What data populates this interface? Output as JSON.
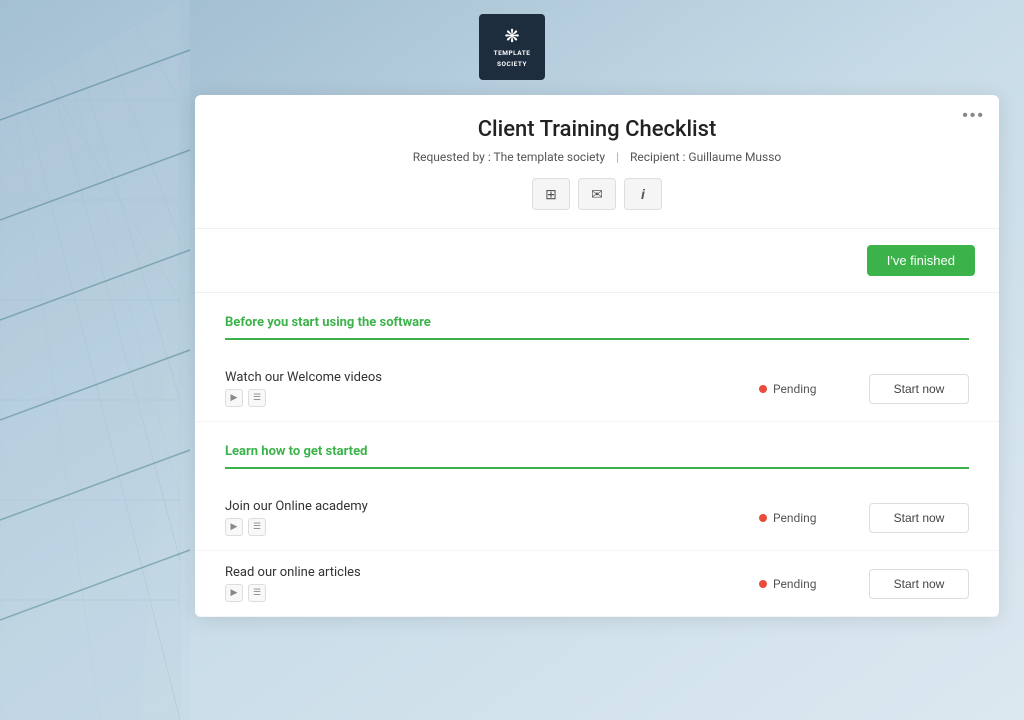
{
  "background": {
    "color_start": "#b8cdd8",
    "color_end": "#dde8f0"
  },
  "logo": {
    "icon": "❋",
    "line1": "TEMPLATE",
    "line2": "SOCIETY"
  },
  "card": {
    "more_btn_label": "•••",
    "title": "Client Training Checklist",
    "meta": {
      "requested_by_label": "Requested by :",
      "requested_by_value": "The template society",
      "separator": "|",
      "recipient_label": "Recipient :",
      "recipient_value": "Guillaume Musso"
    },
    "action_buttons": [
      {
        "id": "grid-btn",
        "icon": "⊞",
        "label": "Grid view"
      },
      {
        "id": "email-btn",
        "icon": "✉",
        "label": "Email"
      },
      {
        "id": "info-btn",
        "icon": "i",
        "label": "Info"
      }
    ],
    "finished_button": "I've finished",
    "sections": [
      {
        "id": "section-1",
        "title": "Before you start using the software",
        "tasks": [
          {
            "id": "task-1",
            "name": "Watch our Welcome videos",
            "status": "Pending",
            "status_color": "#e74c3c",
            "start_label": "Start now"
          }
        ]
      },
      {
        "id": "section-2",
        "title": "Learn how to get started",
        "tasks": [
          {
            "id": "task-2",
            "name": "Join our Online academy",
            "status": "Pending",
            "status_color": "#e74c3c",
            "start_label": "Start now"
          },
          {
            "id": "task-3",
            "name": "Read our online articles",
            "status": "Pending",
            "status_color": "#e74c3c",
            "start_label": "Start now"
          }
        ]
      }
    ]
  }
}
